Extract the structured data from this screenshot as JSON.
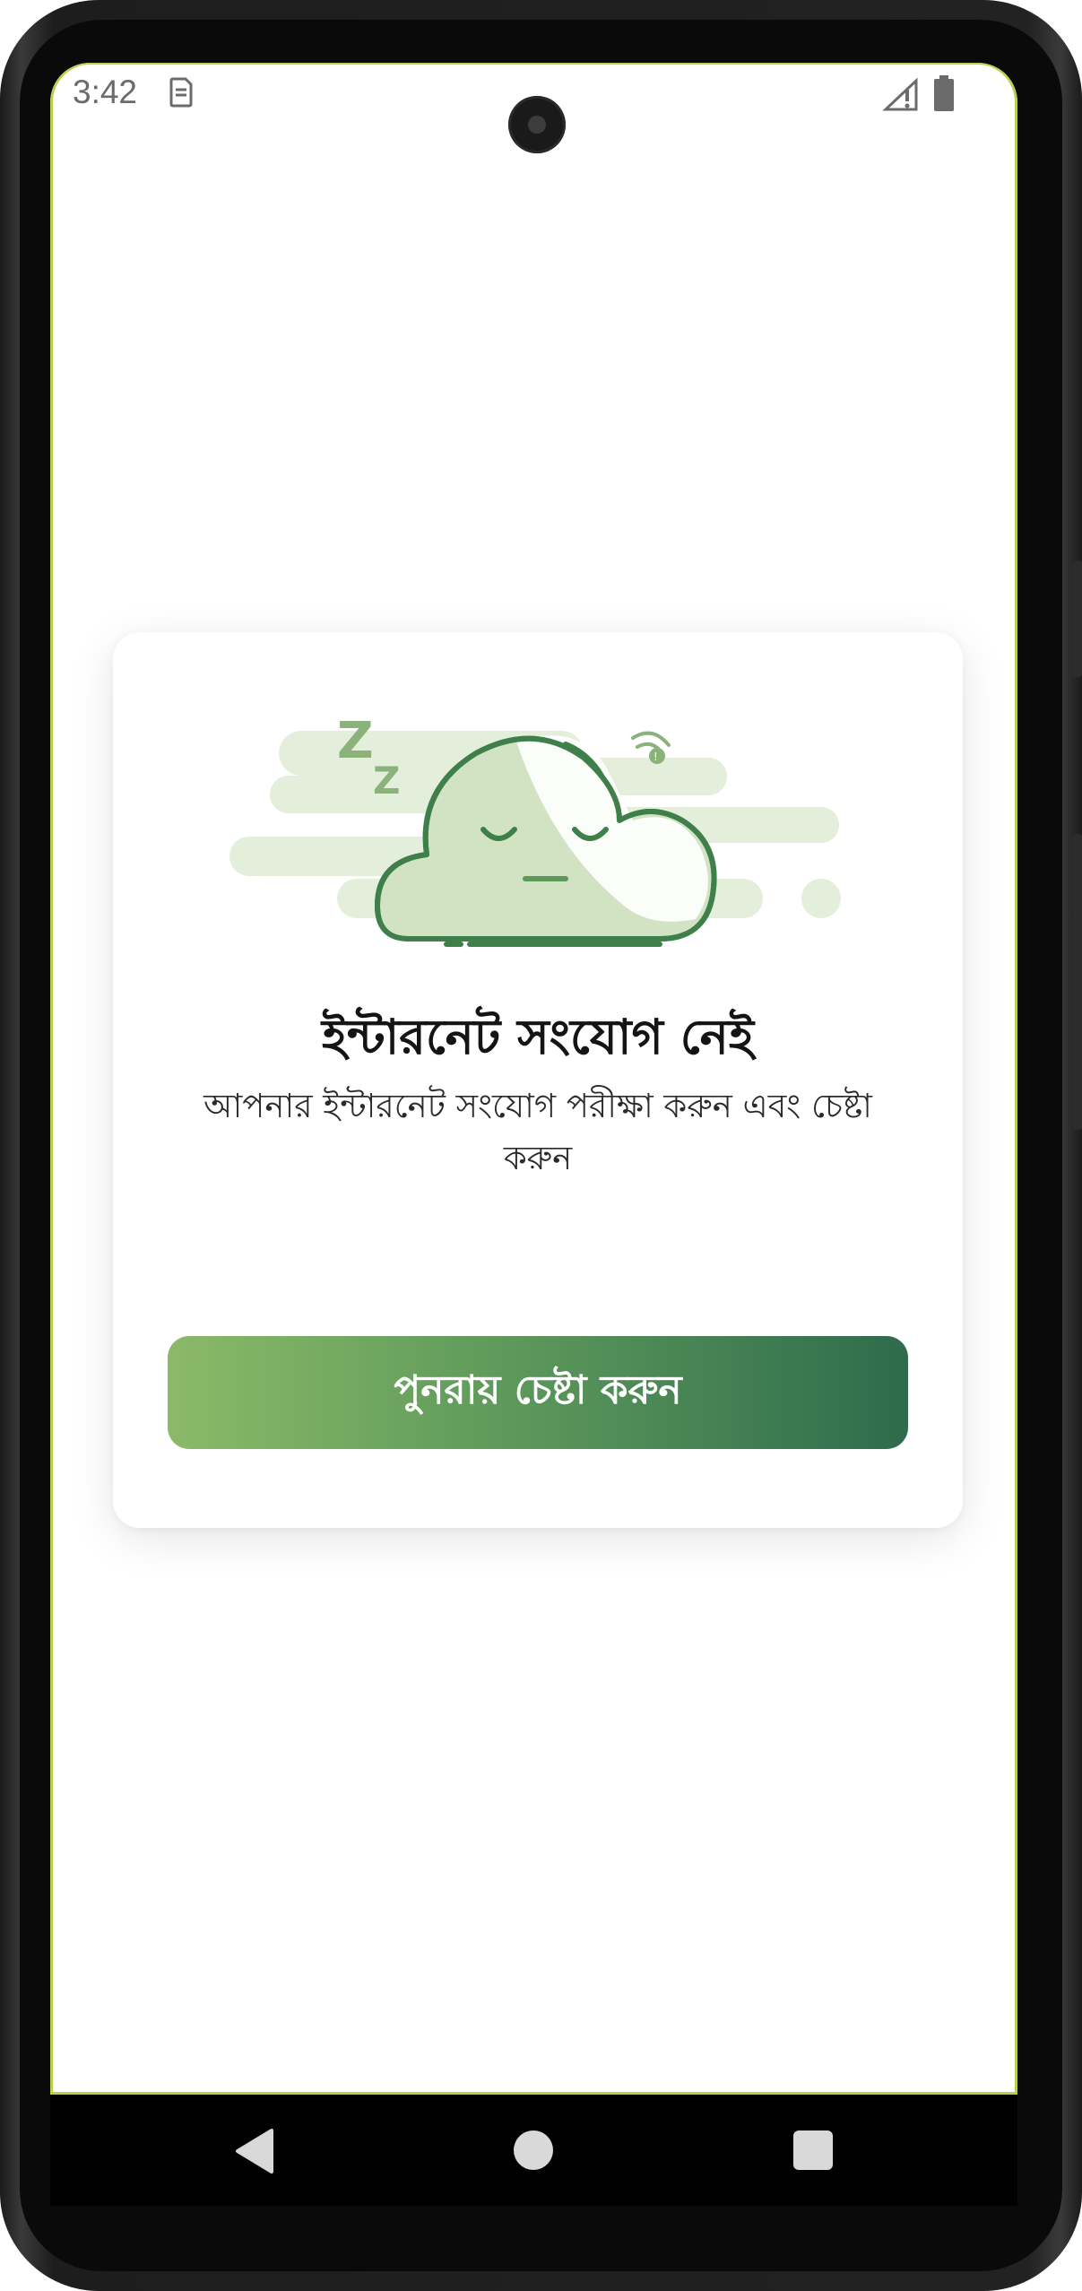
{
  "status_bar": {
    "time": "3:42",
    "icons": [
      "sim-card-icon",
      "signal-icon",
      "battery-icon"
    ]
  },
  "card": {
    "illustration": "sleeping-cloud-no-internet",
    "title": "ইন্টারনেট সংযোগ নেই",
    "subtitle": "আপনার ইন্টারনেট সংযোগ পরীক্ষা করুন এবং চেষ্টা করুন",
    "retry_button_label": "পুনরায় চেষ্টা করুন"
  },
  "navigation": {
    "buttons": [
      "back",
      "home",
      "recents"
    ]
  },
  "colors": {
    "accent_start": "#8bba68",
    "accent_end": "#2f6b4c",
    "frame_border": "#b7d24a",
    "cloud_fill": "#d2e3c4",
    "cloud_stroke": "#3f7f4a"
  }
}
